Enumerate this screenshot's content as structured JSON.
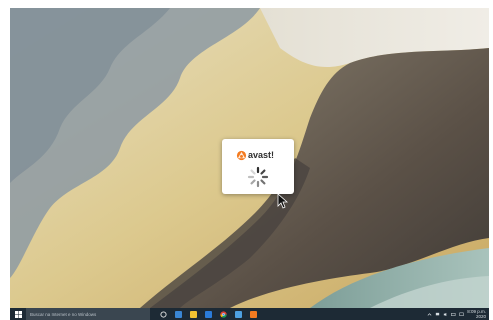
{
  "desktop": {
    "wallpaper": "aerial-sand-and-water"
  },
  "splash": {
    "brand": "avast!",
    "loading_icon": "spinner-icon",
    "colors": {
      "brand_orange": "#f47b20",
      "background": "#ffffff"
    }
  },
  "taskbar": {
    "search_placeholder": "Buscar na Internet e no Windows",
    "pinned_icons": [
      "cortana-icon",
      "task-view-icon",
      "file-explorer-icon",
      "store-icon",
      "chrome-icon",
      "app-icon",
      "avast-icon"
    ],
    "tray": {
      "icons": [
        "chevron-up-icon",
        "network-icon",
        "volume-icon",
        "battery-icon",
        "notification-icon"
      ],
      "time": "8:09 p.m.",
      "date": "2020"
    },
    "colors": {
      "background": "#1d2a35",
      "search_background": "#3a4650"
    }
  }
}
